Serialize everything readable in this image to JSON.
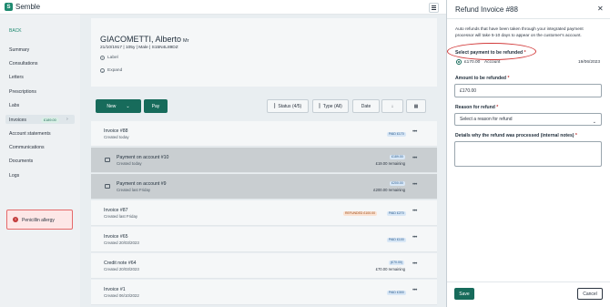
{
  "app": {
    "logo_text": "Semble"
  },
  "sidebar": {
    "back_label": "BACK",
    "items": [
      {
        "label": "Summary"
      },
      {
        "label": "Consultations"
      },
      {
        "label": "Letters"
      },
      {
        "label": "Prescriptions"
      },
      {
        "label": "Labs"
      },
      {
        "label": "Invoices",
        "badge": "£189.00",
        "active": true
      },
      {
        "label": "Account statements"
      },
      {
        "label": "Communications"
      },
      {
        "label": "Documents"
      },
      {
        "label": "Logs"
      }
    ],
    "alert": "Penicillin allergy"
  },
  "patient": {
    "name": "GIACOMETTI, Alberto",
    "title": "Mr",
    "dob": "21/10/1917",
    "age": "105y",
    "sex": "Male",
    "nhs": "S15N4L89DZ",
    "label_action": "Label",
    "expand_action": "Expand"
  },
  "toolbar": {
    "new_label": "New",
    "pay_label": "Pay",
    "status_label": "Status (4/5)",
    "type_label": "Type (All)",
    "date_label": "Date"
  },
  "invoices": [
    {
      "title": "Invoice #88",
      "sub": "Created today",
      "pill": "PAID £170",
      "pill_type": "paid",
      "shaded": false
    },
    {
      "title": "Payment on account #10",
      "sub": "Created today",
      "pill": "£189.00",
      "pill_type": "paid",
      "remaining": "£19.00 remaining",
      "shaded": true,
      "doc": true
    },
    {
      "title": "Payment on account #9",
      "sub": "Created last Friday",
      "pill": "£200.00",
      "pill_type": "paid",
      "remaining": "£200.00 remaining",
      "shaded": true,
      "doc": true
    },
    {
      "title": "Invoice #87",
      "sub": "Created last Friday",
      "pill": "REFUNDED £100.00",
      "pill_type": "refunded",
      "pill2": "PAID £270",
      "shaded": false
    },
    {
      "title": "Invoice #65",
      "sub": "Created 20/03/2023",
      "pill": "PAID £100",
      "pill_type": "paid",
      "shaded": false
    },
    {
      "title": "Credit note #64",
      "sub": "Created 20/03/2023",
      "pill": "(£70.00)",
      "pill_type": "paid",
      "remaining": "£70.00 remaining",
      "shaded": false
    },
    {
      "title": "Invoice #1",
      "sub": "Created 06/10/2022",
      "pill": "PAID £300",
      "pill_type": "paid",
      "shaded": false
    }
  ],
  "refund_panel": {
    "title": "Refund Invoice #88",
    "info": "Auto refunds that have been taken through your integrated payment processor will take 5-10 days to appear on the customer's account.",
    "payment_label": "Select payment to be refunded",
    "payment_amount": "£170.00",
    "payment_method": "Account",
    "payment_date": "19/06/2023",
    "amount_label": "Amount to be refunded",
    "amount_value": "£170.00",
    "reason_label": "Reason for refund",
    "reason_placeholder": "Select a reason for refund",
    "details_label": "Details why the refund was processed (internal notes)",
    "save_label": "Save",
    "cancel_label": "Cancel"
  },
  "colors": {
    "brand": "#176b5b",
    "annotation": "#d23a3a"
  }
}
